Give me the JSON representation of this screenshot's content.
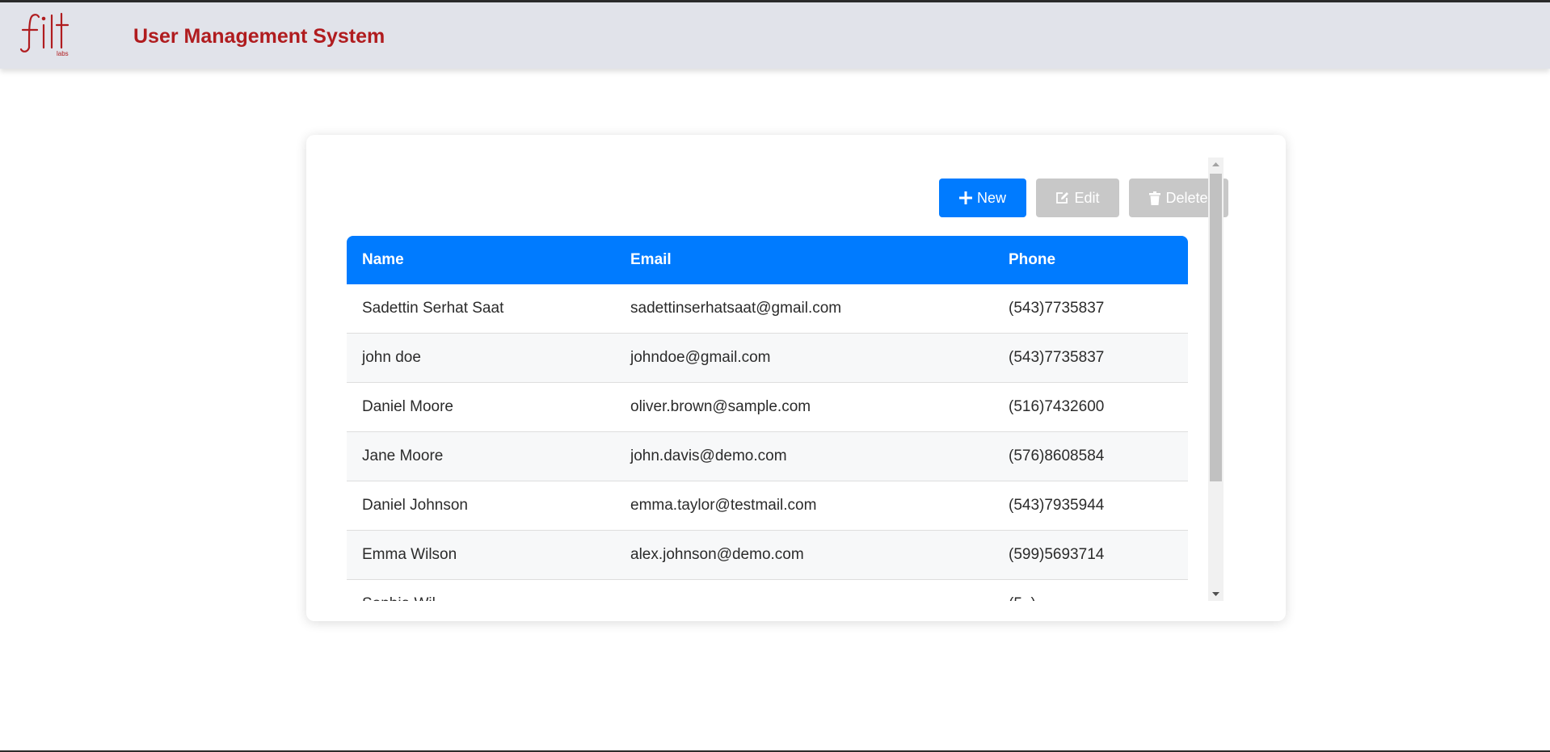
{
  "header": {
    "logo_text": "fill labs",
    "title": "User Management System",
    "brand_color": "#b01c1f"
  },
  "toolbar": {
    "new_label": "New",
    "edit_label": "Edit",
    "delete_label": "Delete",
    "new_icon": "plus-icon",
    "edit_icon": "edit-icon",
    "delete_icon": "trash-icon",
    "primary_color": "#007bff",
    "disabled_color": "#c8c8c8"
  },
  "table": {
    "columns": [
      "Name",
      "Email",
      "Phone"
    ],
    "rows": [
      {
        "name": "Sadettin Serhat Saat",
        "email": "sadettinserhatsaat@gmail.com",
        "phone": "(543)7735837"
      },
      {
        "name": "john doe",
        "email": "johndoe@gmail.com",
        "phone": "(543)7735837"
      },
      {
        "name": "Daniel Moore",
        "email": "oliver.brown@sample.com",
        "phone": "(516)7432600"
      },
      {
        "name": "Jane Moore",
        "email": "john.davis@demo.com",
        "phone": "(576)8608584"
      },
      {
        "name": "Daniel Johnson",
        "email": "emma.taylor@testmail.com",
        "phone": "(543)7935944"
      },
      {
        "name": "Emma Wilson",
        "email": "alex.johnson@demo.com",
        "phone": "(599)5693714"
      },
      {
        "name": "Sophia Wil...",
        "email": "...",
        "phone": "(5..)..."
      }
    ]
  }
}
